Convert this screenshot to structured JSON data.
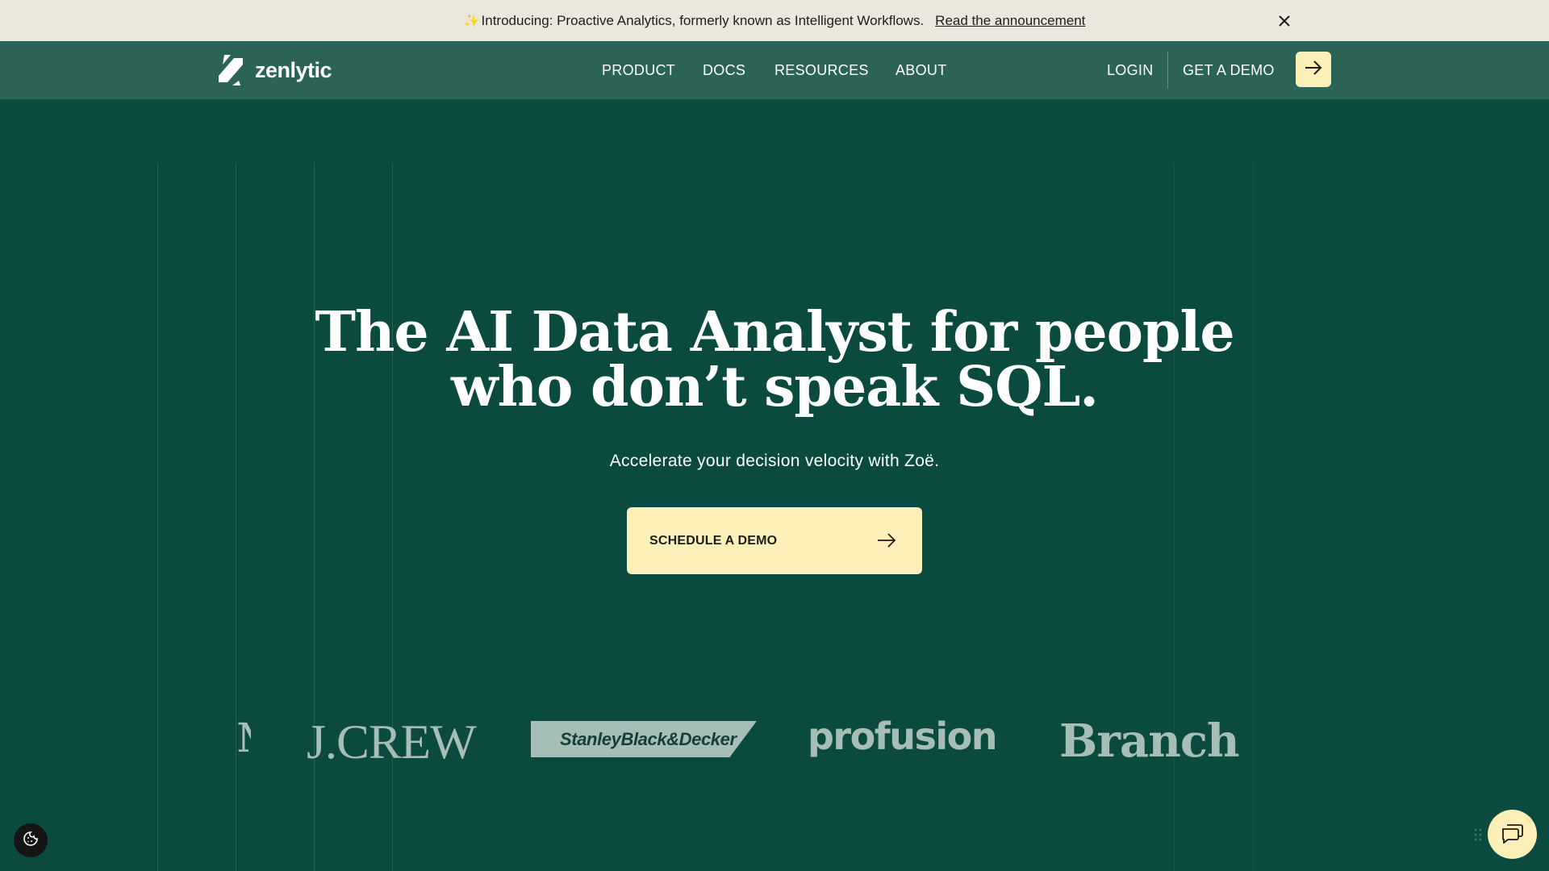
{
  "announcement": {
    "sparkle": "✨",
    "text": "Introducing: Proactive Analytics, formerly known as Intelligent Workflows.",
    "link_label": "Read the announcement",
    "close_icon": "close-icon"
  },
  "nav": {
    "brand_name": "zenlytic",
    "links": [
      "PRODUCT",
      "DOCS",
      "RESOURCES",
      "ABOUT"
    ],
    "login_label": "LOGIN",
    "demo_label": "GET A DEMO",
    "demo_icon": "arrow-right-icon"
  },
  "hero": {
    "title_line1": "The AI Data Analyst for people",
    "title_line2": "who don’t speak SQL.",
    "subtitle": "Accelerate your decision velocity with Zoë.",
    "cta_label": "SCHEDULE A DEMO",
    "cta_icon": "arrow-right-icon"
  },
  "logos": {
    "partial": "M",
    "jcrew": "J.CREW",
    "sbd": "StanleyBlack&Decker",
    "profusion": "profusion",
    "branch": "Branch"
  },
  "widgets": {
    "cookie_icon": "cookie-icon",
    "chat_icon": "chat-icon"
  },
  "colors": {
    "background": "#0b4a3f",
    "nav_background": "#2b6357",
    "announcement_background": "#ece7dd",
    "accent": "#fdefb8",
    "logo_tint": "#a7bdb7"
  }
}
